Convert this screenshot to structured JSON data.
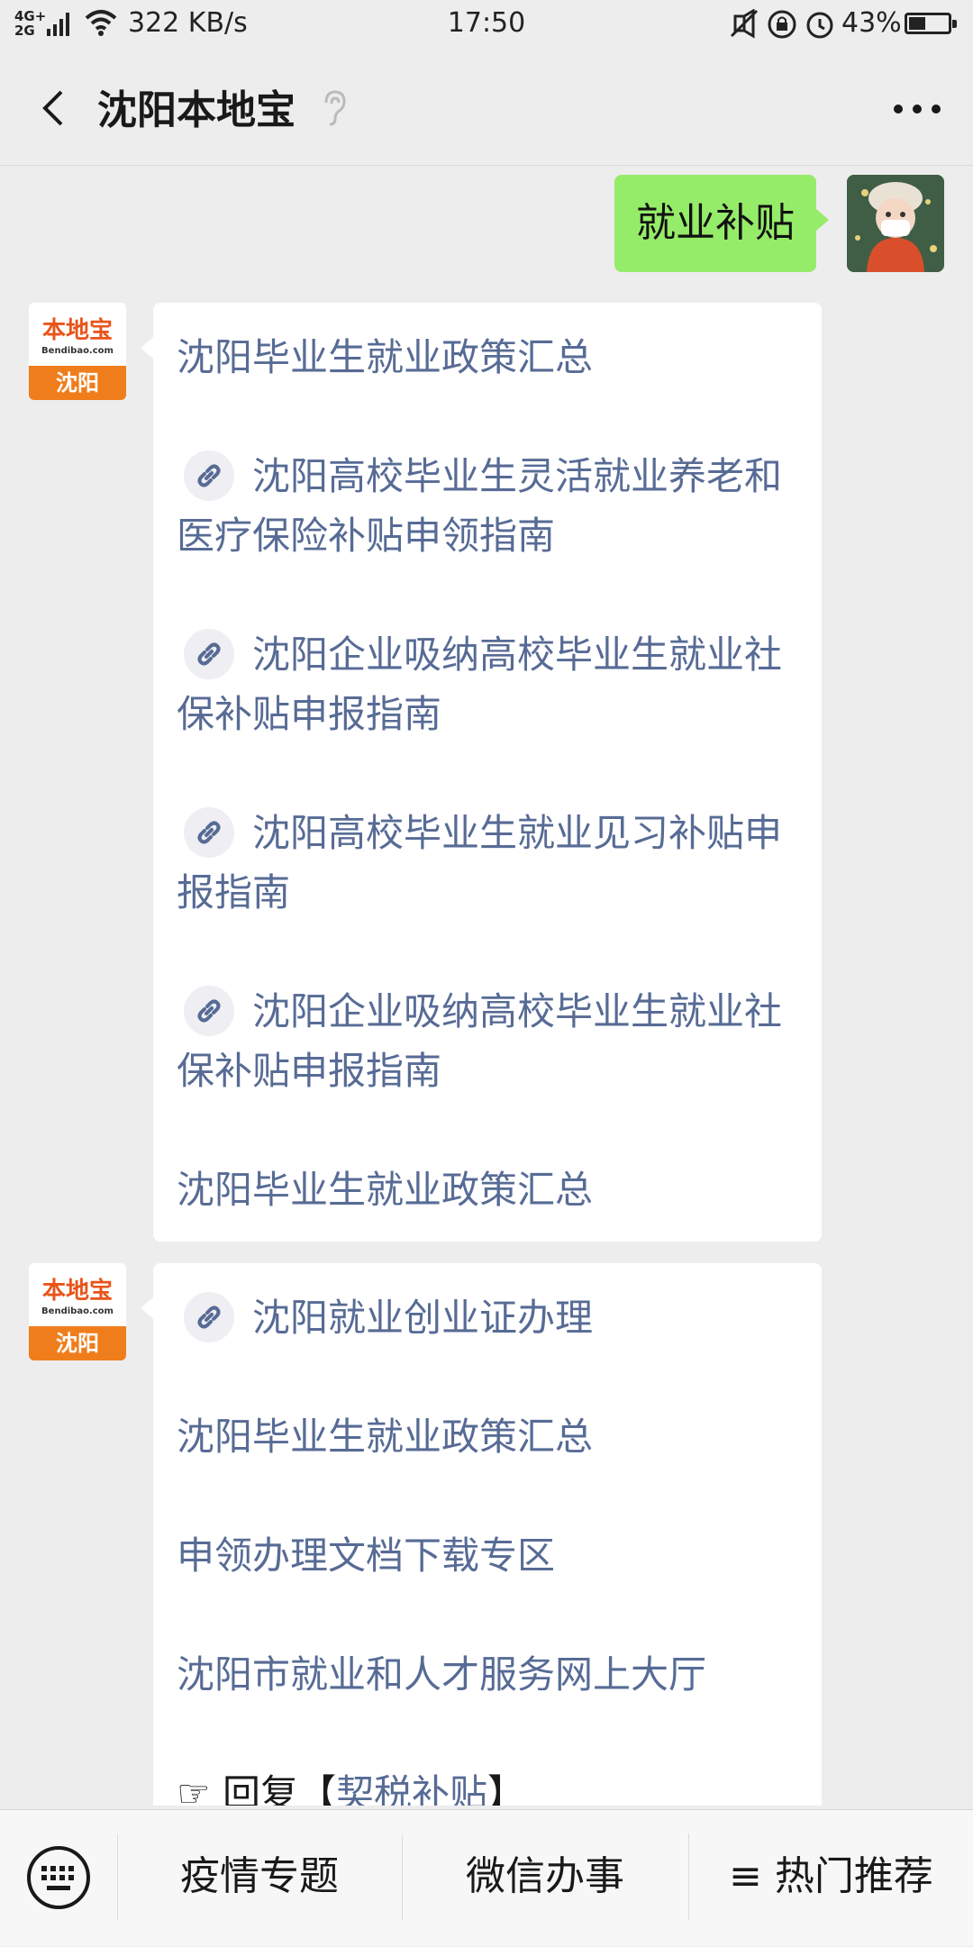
{
  "status_bar": {
    "network": "4G+\n2G",
    "speed": "322 KB/s",
    "time": "17:50",
    "battery_text": "43%",
    "battery_level": 0.43
  },
  "header": {
    "title": "沈阳本地宝"
  },
  "user_message": {
    "text": "就业补贴"
  },
  "bot_avatar": {
    "brand": "本地宝",
    "url": "Bendibao.com",
    "city": "沈阳"
  },
  "bot_message_1": {
    "items": [
      {
        "text": "沈阳毕业生就业政策汇总",
        "has_icon": false
      },
      {
        "text": "沈阳高校毕业生灵活就业养老和医疗保险补贴申领指南",
        "has_icon": true
      },
      {
        "text": "沈阳企业吸纳高校毕业生就业社保补贴申报指南",
        "has_icon": true
      },
      {
        "text": "沈阳高校毕业生就业见习补贴申报指南",
        "has_icon": true
      },
      {
        "text": "沈阳企业吸纳高校毕业生就业社保补贴申报指南",
        "has_icon": true
      },
      {
        "text": "沈阳毕业生就业政策汇总",
        "has_icon": false
      }
    ]
  },
  "bot_message_2": {
    "items": [
      {
        "text": "沈阳就业创业证办理",
        "has_icon": true
      },
      {
        "text": "沈阳毕业生就业政策汇总",
        "has_icon": false
      },
      {
        "text": "申领办理文档下载专区",
        "has_icon": false
      },
      {
        "text": "沈阳市就业和人才服务网上大厅",
        "has_icon": false
      }
    ],
    "reply_prefix": "☞ 回复【",
    "reply_keyword": "契税补贴",
    "reply_suffix": "】"
  },
  "bottom_menu": {
    "items": [
      "疫情专题",
      "微信办事",
      "≡ 热门推荐"
    ]
  },
  "colors": {
    "link": "#576b95",
    "user_bubble": "#95ec69",
    "background": "#ededed"
  }
}
